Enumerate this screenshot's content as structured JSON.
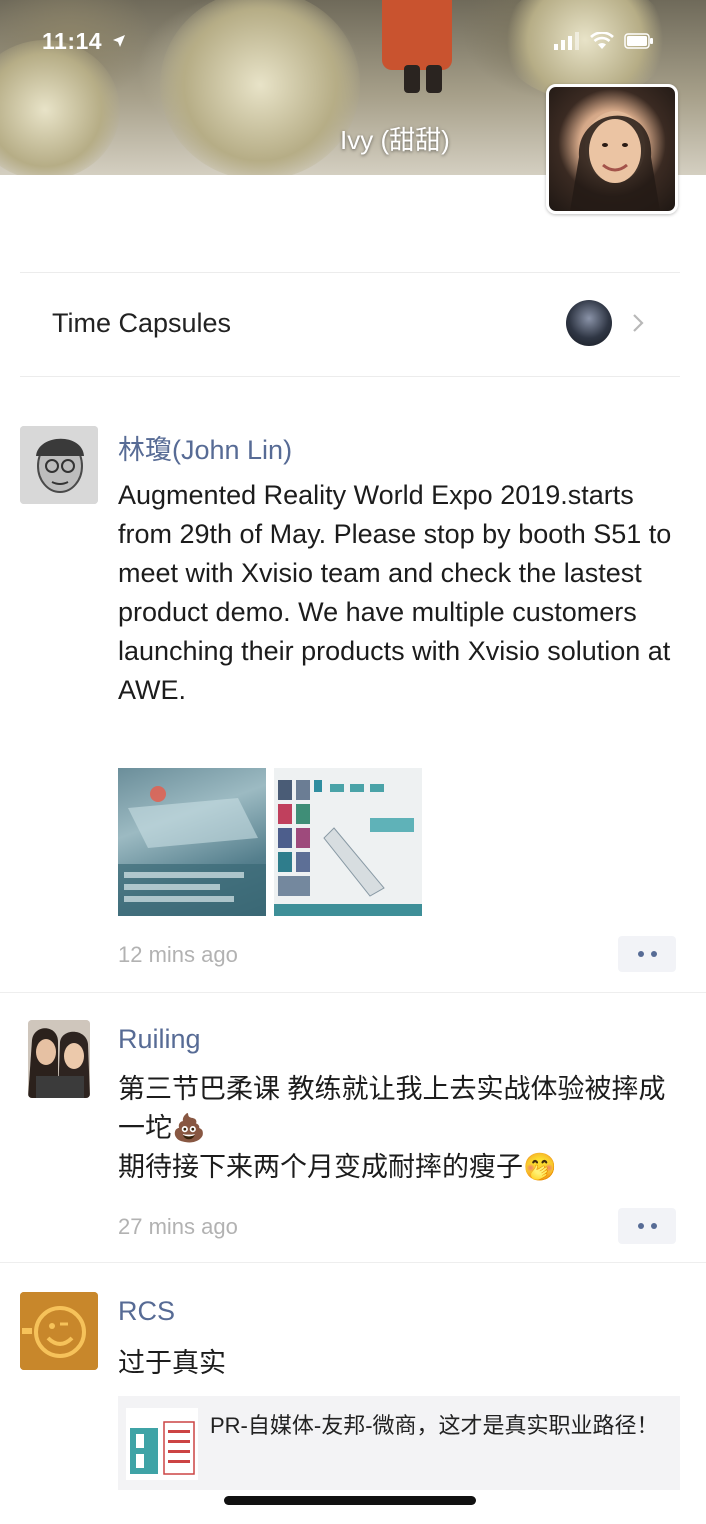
{
  "status_bar": {
    "time": "11:14"
  },
  "cover": {
    "user_name": "Ivy (甜甜)"
  },
  "time_capsules": {
    "label": "Time Capsules"
  },
  "posts": [
    {
      "author": "林瓊(John Lin)",
      "text": "Augmented Reality World Expo 2019.starts from 29th of May.  Please stop by booth S51 to meet with Xvisio team and check the lastest  product demo. We have multiple customers launching their products with Xvisio solution at   AWE.",
      "time": "12 mins ago"
    },
    {
      "author": "Ruiling",
      "text": "第三节巴柔课 教练就让我上去实战体验被摔成一坨💩\n期待接下来两个月变成耐摔的瘦子🤭",
      "time": "27 mins ago"
    },
    {
      "author": "RCS",
      "text": "过于真实",
      "link_title": "PR-自媒体-友邦-微商，这才是真实职业路径！"
    }
  ],
  "colors": {
    "link_blue": "#576b95",
    "timestamp_gray": "#b2b2b2",
    "card_bg": "#f3f3f5"
  },
  "icons": [
    "location-arrow-icon",
    "signal-icon",
    "wifi-icon",
    "battery-icon",
    "chevron-right-icon",
    "more-dots-icon"
  ]
}
